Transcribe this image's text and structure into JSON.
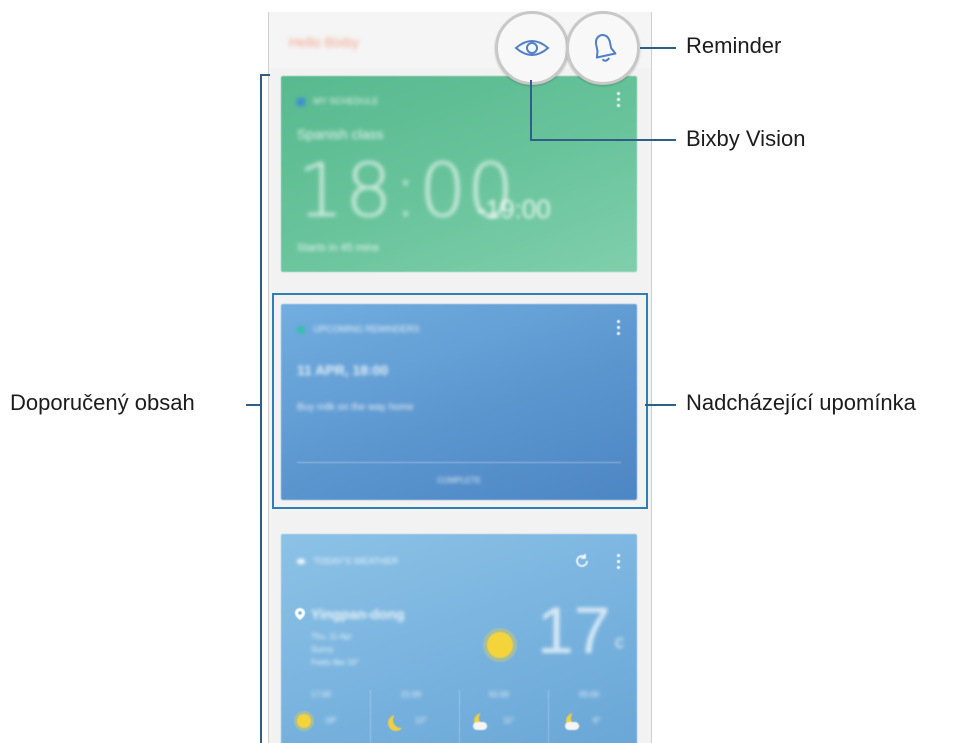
{
  "screen": {
    "title": "Hello Bixby"
  },
  "cards": {
    "schedule": {
      "header": "MY SCHEDULE",
      "event": "Spanish class",
      "start_time": "18:00",
      "end_time": "-19:00",
      "subtitle": "Starts in 45 mins"
    },
    "reminder": {
      "header": "UPCOMING REMINDERS",
      "datetime": "11 APR, 18:00",
      "text": "Buy milk on the way home",
      "action": "COMPLETE"
    },
    "weather": {
      "header": "TODAY'S WEATHER",
      "location": "Yingpan-dong",
      "details": [
        "Thu, 11 Apr",
        "Sunny",
        "Feels like 16°"
      ],
      "temperature": "17",
      "unit": "c",
      "forecast": [
        {
          "time": "17:00",
          "temp": "18°",
          "icon": "sun"
        },
        {
          "time": "21:00",
          "temp": "12°",
          "icon": "moon"
        },
        {
          "time": "01:00",
          "temp": "11°",
          "icon": "moon-cloud"
        },
        {
          "time": "05:00",
          "temp": "9°",
          "icon": "moon-cloud"
        }
      ]
    }
  },
  "icons": {
    "vision": "eye-icon",
    "reminder": "bell-icon",
    "more": "more-vert-icon",
    "refresh": "refresh-icon",
    "location": "location-pin-icon"
  },
  "callouts": {
    "reminder": "Reminder",
    "bixby_vision": "Bixby Vision",
    "recommended": "Doporučený obsah",
    "upcoming": "Nadcházející upomínka"
  },
  "colors": {
    "callout_line": "#2f5f86",
    "highlight": "#2f7fb4",
    "schedule_card": "#62bf96",
    "reminder_card": "#5f9bd2",
    "weather_card": "#7cb6e0"
  }
}
